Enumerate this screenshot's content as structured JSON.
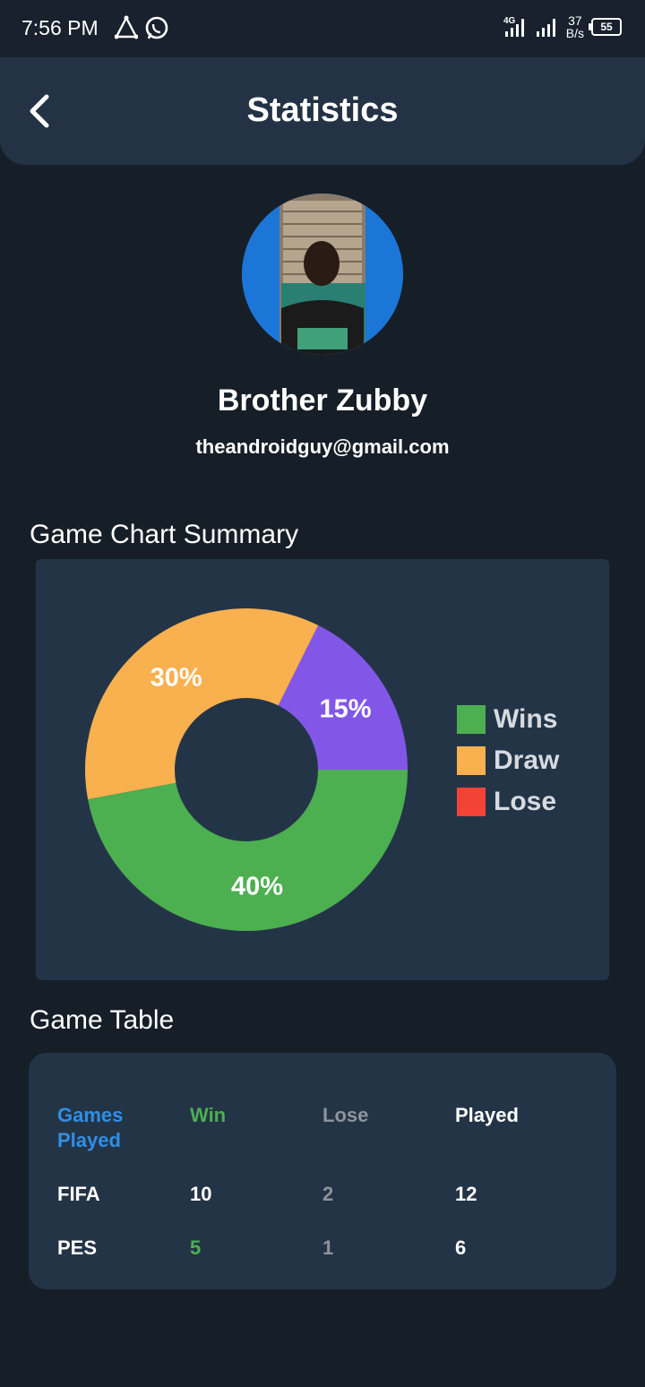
{
  "status_bar": {
    "time": "7:56 PM",
    "network": "4G",
    "speed_value": "37",
    "speed_unit": "B/s",
    "battery": "55"
  },
  "app_bar": {
    "title": "Statistics",
    "back_icon": "chevron-left-icon"
  },
  "profile": {
    "name": "Brother Zubby",
    "email": "theandroidguy@gmail.com"
  },
  "chart_section": {
    "title": "Game Chart Summary"
  },
  "chart_data": {
    "type": "pie",
    "donut": true,
    "categories": [
      "Wins",
      "Draw",
      "Lose"
    ],
    "slices": [
      {
        "label": "40%",
        "value": 40,
        "color": "#4caf50"
      },
      {
        "label": "30%",
        "value": 30,
        "color": "#f9b04f"
      },
      {
        "label": "15%",
        "value": 15,
        "color": "#8257e8"
      }
    ],
    "legend": [
      {
        "name": "Wins",
        "color": "#4caf50"
      },
      {
        "name": "Draw",
        "color": "#f9b04f"
      },
      {
        "name": "Lose",
        "color": "#f44336"
      }
    ],
    "legend_position": "right"
  },
  "table_section": {
    "title": "Game Table"
  },
  "table": {
    "headers": [
      "Games\nPlayed",
      "Win",
      "Lose",
      "Played"
    ],
    "rows": [
      [
        "FIFA",
        "10",
        "2",
        "12"
      ],
      [
        "PES",
        "5",
        "1",
        "6"
      ]
    ]
  },
  "colors": {
    "background": "#161e28",
    "card": "#243447",
    "header_games": "#2f8fe6",
    "win": "#4caf50",
    "lose": "#8c949c"
  }
}
